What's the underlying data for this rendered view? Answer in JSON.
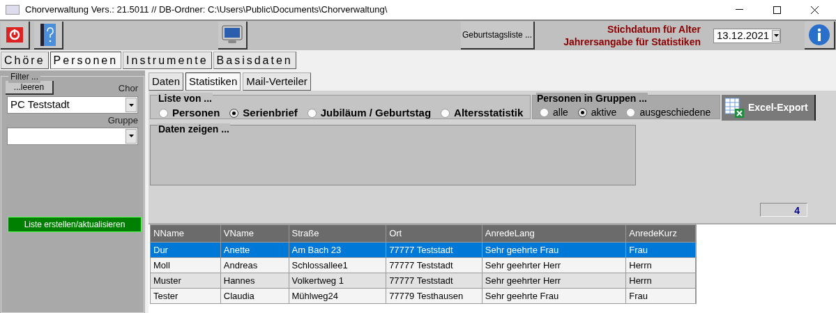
{
  "window": {
    "title": "Chorverwaltung Vers.: 21.5011 // DB-Ordner: C:\\Users\\Public\\Documents\\Chorverwaltung\\"
  },
  "toolbar": {
    "birthday_button": "Geburtstagsliste ...",
    "date_label_1": "Stichdatum für Alter",
    "date_label_2": "Jahrersangabe für Statistiken",
    "date_value": "13.12.2021"
  },
  "main_tabs": [
    {
      "label": "Chöre",
      "selected": false
    },
    {
      "label": "Personen",
      "selected": true
    },
    {
      "label": "Instrumente",
      "selected": false
    },
    {
      "label": "Basisdaten",
      "selected": false
    }
  ],
  "filter": {
    "title": "Filter ...",
    "clear_button": "...leeren",
    "chor_label": "Chor",
    "chor_value": "PC Teststadt",
    "gruppe_label": "Gruppe",
    "create_button": "Liste erstellen/aktualisieren"
  },
  "sub_tabs": [
    {
      "label": "Daten",
      "selected": false
    },
    {
      "label": "Statistiken",
      "selected": true
    },
    {
      "label": "Mail-Verteiler",
      "selected": false
    }
  ],
  "list_of": {
    "title": "Liste von ...",
    "options": [
      {
        "label": "Personen",
        "selected": false
      },
      {
        "label": "Serienbrief",
        "selected": true
      },
      {
        "label": "Jubiläum / Geburtstag",
        "selected": false
      },
      {
        "label": "Altersstatistik",
        "selected": false
      }
    ]
  },
  "persons_in_groups": {
    "title": "Personen in Gruppen ...",
    "options": [
      {
        "label": "alle",
        "selected": false
      },
      {
        "label": "aktive",
        "selected": true
      },
      {
        "label": "ausgeschiedene",
        "selected": false
      }
    ]
  },
  "excel_button": "Excel-Export",
  "show_data": {
    "title": "Daten zeigen ..."
  },
  "count": "4",
  "table": {
    "columns": [
      "NName",
      "VName",
      "Straße",
      "Ort",
      "AnredeLang",
      "AnredeKurz"
    ],
    "rows": [
      {
        "cells": [
          "Dur",
          "Anette",
          "Am Bach 23",
          "77777 Teststadt",
          "Sehr geehrte Frau",
          "Frau"
        ],
        "selected": true
      },
      {
        "cells": [
          "Moll",
          "Andreas",
          "Schlossallee1",
          "77777 Teststadt",
          "Sehr geehrter Herr",
          "Herrn"
        ],
        "selected": false
      },
      {
        "cells": [
          "Muster",
          "Hannes",
          "Volkertweg 1",
          "77777 Teststadt",
          "Sehr geehrter Herr",
          "Herrn"
        ],
        "selected": false
      },
      {
        "cells": [
          "Tester",
          "Claudia",
          "Mühlweg24",
          "77779 Testhausen",
          "Sehr geehrte Frau",
          "Frau"
        ],
        "selected": false
      }
    ]
  }
}
